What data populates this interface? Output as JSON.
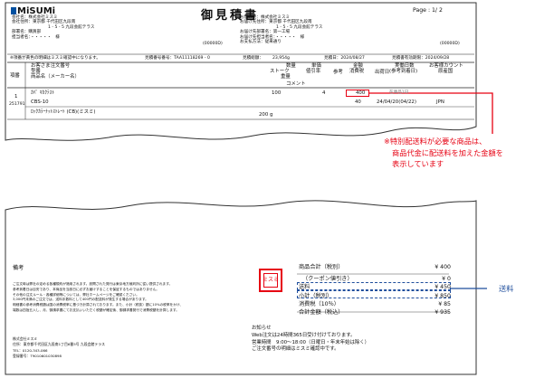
{
  "doc": {
    "logo": "MiSUMi",
    "title": "御見積書",
    "page": "Page : 1/ 2"
  },
  "left_header": {
    "company_name": "会社名：株式会社ミスミ",
    "address1": "会社住所：東京都 千代田区九段南",
    "address2": "1 - 5 - 5 九段会館テラス",
    "dept": "部署名：購買部",
    "person": "担当者名：・・・・・　様",
    "code": "(00000D)"
  },
  "right_header": {
    "company_name": "お届け先：株式会社ミスミ",
    "address1": "お届け先住所：東京都 千代田区九段南",
    "address2": "1 - 5 - 5 九段会館テラス",
    "dept": "お届け先部署名：第一工場",
    "person": "お届け先担当者名：・・・・・　様",
    "code": "(00000D)",
    "payment": "お支払方法：従来通り"
  },
  "info_row": {
    "note": "※項番が黄色の明細はミスミ確認中になります。",
    "quote_no_label": "見積番号番号：",
    "quote_no": "TAA11118269 - 0",
    "amount_label": "見積総額：",
    "amount": "23,954g",
    "date_label": "見積日：2024/08/27",
    "valid_label": "見積書有効期限：2024/09/28"
  },
  "table": {
    "head_item": "項番",
    "head_desc": [
      "お客さま注文番号",
      "型番",
      "商品名（メーカー名）"
    ],
    "head_qty": [
      "数量",
      "ストーク",
      "重量"
    ],
    "head_unit": [
      "単価",
      "値引率"
    ],
    "head_ref": "参考",
    "head_amount": [
      "金額",
      "消費税"
    ],
    "head_ship": [
      "出荷日",
      "コメント"
    ],
    "head_days": [
      "実働日数",
      "(参考到着日)"
    ],
    "head_discount": [
      "お客様カウント",
      "原産国"
    ],
    "row": {
      "no": "1",
      "sub_no": "251791",
      "order_no": "ｶﾊﾟ ｷｶｸﾃｽﾄ",
      "model": "CBS-10",
      "name": "ﾛｯｸｶﾗｰﾅｯﾄｽﾄﾚｰﾄ (CB)(ミスミ)",
      "qty": "100",
      "weight": "200 g",
      "unit_price": "4",
      "amount": "400",
      "tax": "40",
      "ship_note": "在庫品1日",
      "arrival": "24/04/20(04/22)",
      "origin": "JPN"
    }
  },
  "callout_shipping_note": [
    "※特別配送料が必要な商品は、",
    "商品代金に配送料を加えた金額を",
    "表示しています"
  ],
  "footer": {
    "remarks_label": "備考",
    "remarks": [
      "ご注文時は弊社の定める各種規約が適用されます。設問された発行は東京地方裁判所に従い提供されます。",
      "参考到着日は目安であり、本商品を当該日に必ずお届けすることを保証するものではありません。",
      "その他の注文ルール・各種詳細等については、弊社ホームページをご確認ください。",
      "3,000円未満のご注文では、送料手数料として400円の配送料が発生する場合があります。",
      "明細書の参考消費税額は国の消費税率に基づき計算されております。また、小計（税抜）額に10%の税率をかけ、",
      "端数は四捨五入し、月、御請求書にてお支払いいただく税額が確定後、御請求書発行で消費税額を計算します。"
    ],
    "summary": {
      "subtotal_label": "商品合計（税別）",
      "subtotal": "¥ 400",
      "coupon_label": "（クーポン値引き）",
      "coupon": "¥ 0",
      "shipping_label": "送料",
      "shipping": "¥ 450",
      "sub2_label": "小計（税別）",
      "sub2": "¥ 850",
      "tax_label": "消費税（10％）",
      "tax": "¥ 85",
      "total_label": "合計金額（税込）",
      "total": "¥ 935"
    },
    "shipping_callout": "送料",
    "seal_text": "ミスミ",
    "company_block": [
      "株式会社ミスミ",
      "住所：東京都千代田区九段南1丁目6番5号 九段会館テラス",
      "TEL：0120-343-066",
      "登録番号：T9010601030898"
    ],
    "notice_block": [
      "お知らせ",
      "Web注文は24時間365日受け付けております。",
      "営業時間　9:00～18:00（日曜日・年末年始は除く）",
      "ご注文番号の明細はミスミ確認中です。"
    ]
  }
}
